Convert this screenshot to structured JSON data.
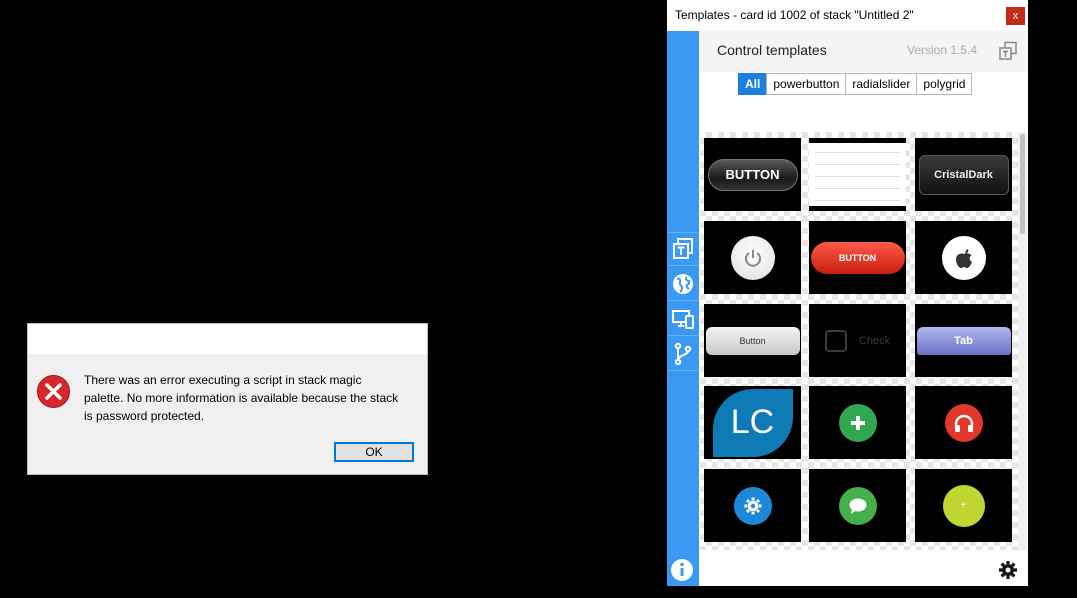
{
  "dialog": {
    "message": "There was an error executing a script in stack magic palette.  No more information is available because the stack is password protected.",
    "ok_label": "OK"
  },
  "palette": {
    "window_title": "Templates - card id 1002 of stack \"Untitled 2\"",
    "close_label": "x",
    "heading": "Control templates",
    "version": "Version 1.5.4",
    "tabs": [
      {
        "label": "All",
        "active": true
      },
      {
        "label": "powerbutton"
      },
      {
        "label": "radialslider"
      },
      {
        "label": "polygrid"
      }
    ],
    "templates": [
      {
        "label": "BUTTON"
      },
      {
        "label": "table"
      },
      {
        "label": "CristalDark"
      },
      {
        "label": "power"
      },
      {
        "label": "BUTTON"
      },
      {
        "label": "apple"
      },
      {
        "label": "Button"
      },
      {
        "label": "Check"
      },
      {
        "label": "Tab"
      },
      {
        "label": "LC"
      },
      {
        "label": "plus"
      },
      {
        "label": "headphones"
      },
      {
        "label": "gear"
      },
      {
        "label": "chat"
      },
      {
        "label": "+"
      }
    ]
  },
  "colors": {
    "sidebar": "#3a99f2",
    "tab_active": "#1a7fe0",
    "close": "#c42b1c",
    "error_icon": "#d7262c"
  }
}
